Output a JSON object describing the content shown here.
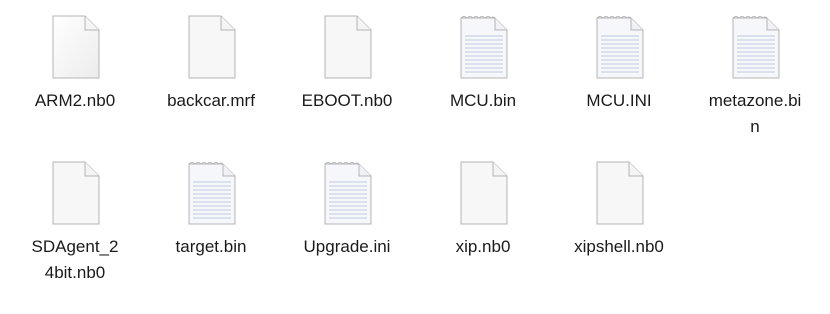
{
  "files": [
    {
      "name": "ARM2.nb0",
      "icon": "blank-file-icon"
    },
    {
      "name": "backcar.mrf",
      "icon": "blank-file-icon"
    },
    {
      "name": "EBOOT.nb0",
      "icon": "blank-file-icon"
    },
    {
      "name": "MCU.bin",
      "icon": "text-file-icon"
    },
    {
      "name": "MCU.INI",
      "icon": "text-file-icon"
    },
    {
      "name": "metazone.bin",
      "icon": "text-file-icon"
    },
    {
      "name": "SDAgent_24bit.nb0",
      "icon": "blank-file-icon"
    },
    {
      "name": "target.bin",
      "icon": "text-file-icon"
    },
    {
      "name": "Upgrade.ini",
      "icon": "text-file-icon"
    },
    {
      "name": "xip.nb0",
      "icon": "blank-file-icon"
    },
    {
      "name": "xipshell.nb0",
      "icon": "blank-file-icon"
    }
  ],
  "colors": {
    "background": "#ffffff",
    "label_text": "#1a1a1a",
    "icon_outline": "#b5b5b5",
    "lined_paper": "#c9d3e3"
  }
}
